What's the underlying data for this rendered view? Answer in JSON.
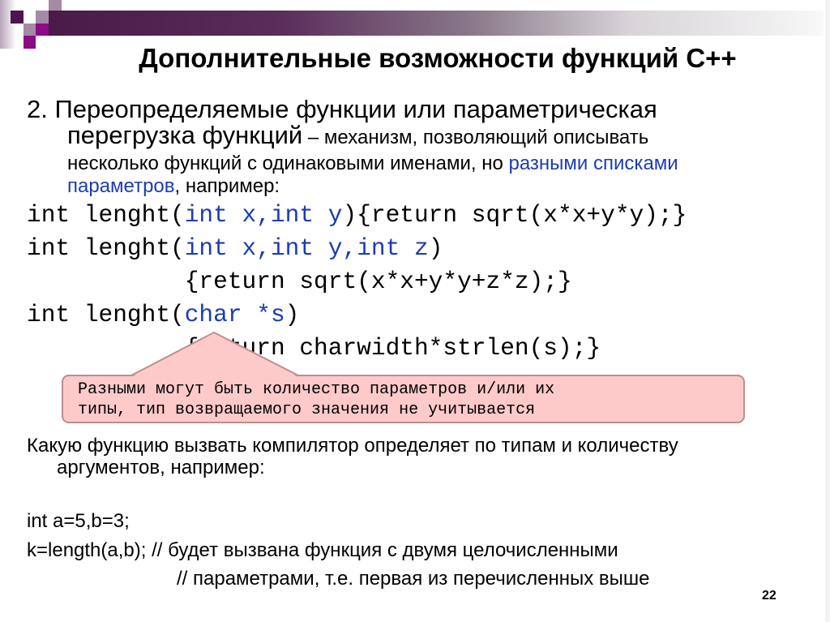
{
  "slide": {
    "title": "Дополнительные возможности функций C++",
    "page_number": "22",
    "colors": {
      "accent_dark": "#4a1a48",
      "accent_magenta": "#8b0c84",
      "link_blue": "#1c3cb4",
      "callout_fill": "#fdc9c9",
      "callout_border": "#bf8c8c"
    }
  },
  "intro": {
    "line1": "2. Переопределяемые функции или параметрическая",
    "line2_big": "перегрузка функций",
    "line2_rest": " – механизм, позволяющий описывать",
    "line3_plain": "несколько функций с одинаковыми именами, но ",
    "line3_blue": "разными списками",
    "line4_blue": "параметров",
    "line4_rest": ", например:"
  },
  "code": {
    "line1": {
      "a": "int lenght(",
      "b": "int x,int y",
      "c": "){return sqrt(x*x+y*y);}"
    },
    "line2": {
      "a": "int lenght(",
      "b": "int x,int y,int z",
      "c": ")"
    },
    "line3": {
      "a": "           {return sqrt(x*x+y*y+z*z);}"
    },
    "line4": {
      "a": "int lenght(",
      "b": "char *s",
      "c": ")"
    },
    "line5": {
      "a": "           {return charwidth*strlen(s);}"
    }
  },
  "callout": {
    "line1": "Разными могут быть количество параметров и/или их",
    "line2": "типы, тип возвращаемого значения не учитывается"
  },
  "body": {
    "para1_line1": "Какую функцию вызвать компилятор определяет по типам и количеству",
    "para1_line2": "аргументов, например:",
    "example_line1": "int a=5,b=3;",
    "example_line2": "k=length(a,b); // будет вызвана функция с двумя целочисленными",
    "example_line3": "// параметрами, т.е. первая из перечисленных выше"
  }
}
